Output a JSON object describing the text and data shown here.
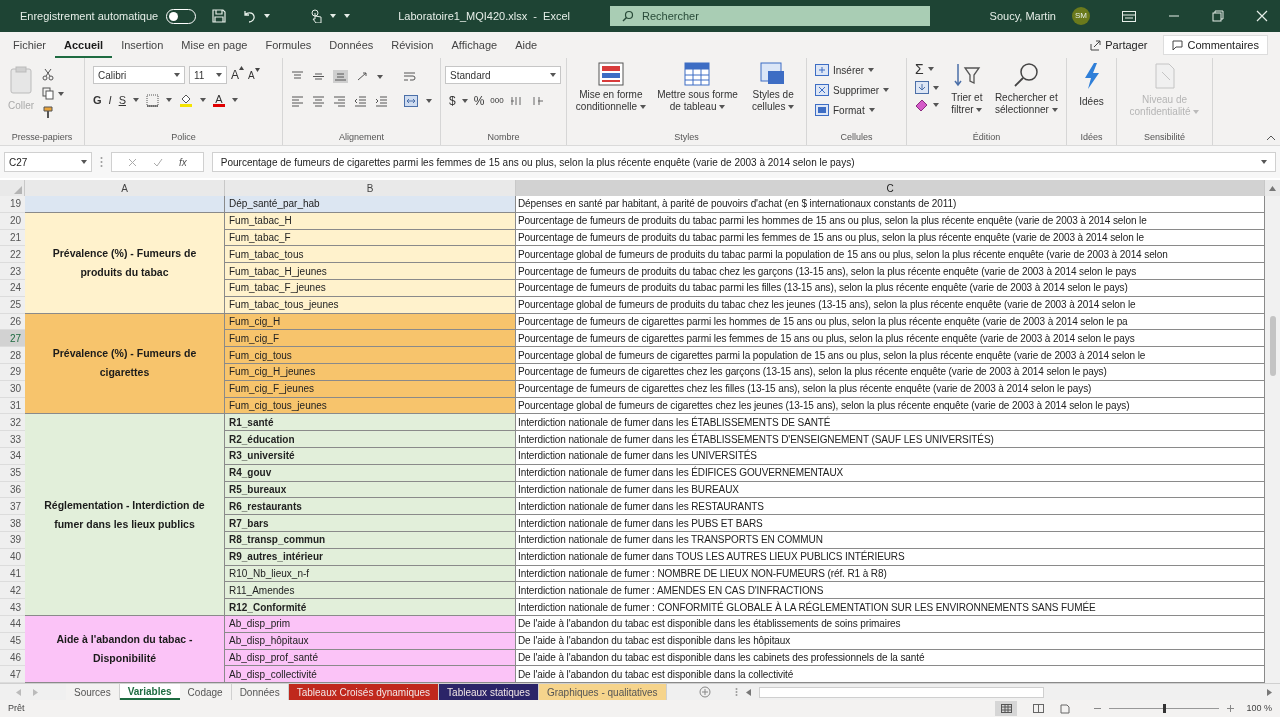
{
  "title_bar": {
    "autosave_label": "Enregistrement automatique",
    "autosave_on": false,
    "file_name": "Laboratoire1_MQI420.xlsx  -  Excel",
    "search_placeholder": "Rechercher",
    "user_name": "Soucy, Martin",
    "user_initials": "SM"
  },
  "menu_tabs": [
    {
      "label": "Fichier",
      "selected": false
    },
    {
      "label": "Accueil",
      "selected": true
    },
    {
      "label": "Insertion",
      "selected": false
    },
    {
      "label": "Mise en page",
      "selected": false
    },
    {
      "label": "Formules",
      "selected": false
    },
    {
      "label": "Données",
      "selected": false
    },
    {
      "label": "Révision",
      "selected": false
    },
    {
      "label": "Affichage",
      "selected": false
    },
    {
      "label": "Aide",
      "selected": false
    }
  ],
  "share_button": "Partager",
  "comments_button": "Commentaires",
  "ribbon": {
    "clipboard": {
      "label": "Presse-papiers",
      "paste": "Coller",
      "paste_disabled": true
    },
    "font": {
      "label": "Police",
      "font_name": "Calibri",
      "font_size": "11",
      "grow": "A",
      "shrink": "A",
      "bold": "G",
      "italic": "I",
      "underline": "S",
      "font_color": "A"
    },
    "alignment": {
      "label": "Alignement"
    },
    "number": {
      "label": "Nombre",
      "format": "Standard",
      "currency": "$",
      "percent": "%",
      "thousands": "000"
    },
    "styles": {
      "label": "Styles",
      "buttons": [
        "Mise en forme conditionnelle",
        "Mettre sous forme de tableau",
        "Styles de cellules"
      ]
    },
    "cells": {
      "label": "Cellules",
      "buttons": [
        "Insérer",
        "Supprimer",
        "Format"
      ]
    },
    "editing": {
      "label": "Édition",
      "sum": "Σ",
      "sort": "Trier et filtrer",
      "find": "Rechercher et sélectionner"
    },
    "ideas": {
      "label": "Idées",
      "button": "Idées"
    },
    "sensitivity": {
      "label": "Sensibilité",
      "button": "Niveau de confidentialité",
      "disabled": true
    }
  },
  "formula_bar": {
    "name_box": "C27",
    "function_label": "fx",
    "formula": "Pourcentage de fumeurs de cigarettes parmi les femmes de 15 ans ou plus, selon la plus récente enquête (varie de 2003 à 2014 selon le pays)"
  },
  "columns": [
    {
      "label": "A",
      "selected": false
    },
    {
      "label": "B",
      "selected": false
    },
    {
      "label": "C",
      "selected": true
    }
  ],
  "groups": [
    {
      "color": "#dce6f2",
      "rows": [
        {
          "number": "19",
          "selected": false,
          "bold": false,
          "variable": "Dép_santé_par_hab",
          "description": "Dépenses en santé par habitant, à parité de pouvoirs d'achat (en $ internationaux constants de 2011)"
        }
      ]
    },
    {
      "label": "Prévalence (%) - Fumeurs de produits du tabac",
      "color": "#fff2cc",
      "rows": [
        {
          "number": "20",
          "selected": false,
          "bold": false,
          "variable": "Fum_tabac_H",
          "description": "Pourcentage de fumeurs de produits du tabac parmi les hommes de 15 ans ou plus, selon la plus récente enquête (varie de 2003 à 2014 selon le"
        },
        {
          "number": "21",
          "selected": false,
          "bold": false,
          "variable": "Fum_tabac_F",
          "description": "Pourcentage de fumeurs de produits du tabac parmi les femmes de 15 ans ou plus, selon la plus récente enquête (varie de 2003 à 2014 selon le"
        },
        {
          "number": "22",
          "selected": false,
          "bold": false,
          "variable": "Fum_tabac_tous",
          "description": "Pourcentage global de fumeurs de produits du tabac parmi la population de 15 ans ou plus, selon la plus récente enquête (varie de 2003 à 2014 selon"
        },
        {
          "number": "23",
          "selected": false,
          "bold": false,
          "variable": "Fum_tabac_H_jeunes",
          "description": "Pourcentage de fumeurs de produits du tabac chez les garçons (13-15 ans), selon la plus récente enquête (varie de 2003 à 2014 selon le pays"
        },
        {
          "number": "24",
          "selected": false,
          "bold": false,
          "variable": "Fum_tabac_F_jeunes",
          "description": "Pourcentage de fumeurs de produits du tabac parmi les filles (13-15 ans), selon la plus récente enquête (varie de 2003 à 2014 selon le pays)"
        },
        {
          "number": "25",
          "selected": false,
          "bold": false,
          "variable": "Fum_tabac_tous_jeunes",
          "description": "Pourcentage global de fumeurs de produits du tabac chez les jeunes (13-15 ans), selon la plus récente enquête (varie de 2003 à 2014 selon le"
        }
      ]
    },
    {
      "label": "Prévalence (%) - Fumeurs de cigarettes",
      "color": "#f7c46c",
      "rows": [
        {
          "number": "26",
          "selected": false,
          "bold": false,
          "variable": "Fum_cig_H",
          "description": "Pourcentage de fumeurs de cigarettes parmi les hommes de 15 ans ou plus, selon la plus récente enquête (varie de 2003 à 2014 selon le pa"
        },
        {
          "number": "27",
          "selected": true,
          "bold": false,
          "variable": "Fum_cig_F",
          "description": "Pourcentage de fumeurs de cigarettes parmi les femmes de 15 ans ou plus, selon la plus récente enquête (varie de 2003 à 2014 selon le pays"
        },
        {
          "number": "28",
          "selected": false,
          "bold": false,
          "variable": "Fum_cig_tous",
          "description": "Pourcentage global de fumeurs de cigarettes parmi la population de 15 ans ou plus, selon la plus récente enquête (varie de 2003 à 2014 selon le"
        },
        {
          "number": "29",
          "selected": false,
          "bold": false,
          "variable": "Fum_cig_H_jeunes",
          "description": "Pourcentage de fumeurs de cigarettes chez les garçons (13-15 ans), selon la plus récente enquête (varie de 2003 à 2014 selon le pays)"
        },
        {
          "number": "30",
          "selected": false,
          "bold": false,
          "variable": "Fum_cig_F_jeunes",
          "description": "Pourcentage de fumeurs de cigarettes chez les filles (13-15 ans), selon la plus récente enquête (varie de 2003 à 2014 selon le pays)"
        },
        {
          "number": "31",
          "selected": false,
          "bold": false,
          "variable": "Fum_cig_tous_jeunes",
          "description": "Pourcentage global de fumeurs de cigarettes chez les jeunes (13-15 ans), selon la plus récente enquête (varie de 2003 à 2014 selon le pays)"
        }
      ]
    },
    {
      "label": "Réglementation - Interdiction de fumer dans les lieux publics",
      "color": "#e2efda",
      "rows": [
        {
          "number": "32",
          "selected": false,
          "bold": true,
          "variable": "R1_santé",
          "description": "Interdiction nationale de fumer dans les ÉTABLISSEMENTS DE SANTÉ"
        },
        {
          "number": "33",
          "selected": false,
          "bold": true,
          "variable": "R2_éducation",
          "description": "Interdiction nationale de fumer dans les ÉTABLISSEMENTS D'ENSEIGNEMENT (SAUF LES UNIVERSITÉS)"
        },
        {
          "number": "34",
          "selected": false,
          "bold": true,
          "variable": "R3_université",
          "description": "Interdiction nationale de fumer dans les UNIVERSITÉS"
        },
        {
          "number": "35",
          "selected": false,
          "bold": true,
          "variable": "R4_gouv",
          "description": "Interdiction nationale de fumer dans les ÉDIFICES GOUVERNEMENTAUX"
        },
        {
          "number": "36",
          "selected": false,
          "bold": true,
          "variable": "R5_bureaux",
          "description": "Interdiction nationale de fumer dans les BUREAUX"
        },
        {
          "number": "37",
          "selected": false,
          "bold": true,
          "variable": "R6_restaurants",
          "description": "Interdiction nationale de fumer dans les RESTAURANTS"
        },
        {
          "number": "38",
          "selected": false,
          "bold": true,
          "variable": "R7_bars",
          "description": "Interdiction nationale de fumer dans les PUBS ET BARS"
        },
        {
          "number": "39",
          "selected": false,
          "bold": true,
          "variable": "R8_transp_commun",
          "description": "Interdiction nationale de fumer dans les TRANSPORTS EN COMMUN"
        },
        {
          "number": "40",
          "selected": false,
          "bold": true,
          "variable": "R9_autres_intérieur",
          "description": "Interdiction nationale de fumer dans TOUS LES AUTRES LIEUX PUBLICS INTÉRIEURS"
        },
        {
          "number": "41",
          "selected": false,
          "bold": false,
          "variable": "R10_Nb_lieux_n-f",
          "description": "Interdiction nationale de fumer : NOMBRE DE LIEUX NON-FUMEURS (réf. R1 à R8)"
        },
        {
          "number": "42",
          "selected": false,
          "bold": false,
          "variable": "R11_Amendes",
          "description": "Interdiction nationale de fumer : AMENDES EN CAS D'INFRACTIONS"
        },
        {
          "number": "43",
          "selected": false,
          "bold": true,
          "variable": "R12_Conformité",
          "description": "Interdiction nationale de fumer : CONFORMITÉ GLOBALE À LA RÉGLEMENTATION SUR LES ENVIRONNEMENTS SANS FUMÉE"
        }
      ]
    },
    {
      "label": "Aide à l'abandon du tabac - Disponibilité",
      "color": "#fbc3f7",
      "rows": [
        {
          "number": "44",
          "selected": false,
          "bold": false,
          "variable": "Ab_disp_prim",
          "description": "De l'aide à l'abandon du tabac est disponible dans les établissements de soins primaires"
        },
        {
          "number": "45",
          "selected": false,
          "bold": false,
          "variable": "Ab_disp_hôpitaux",
          "description": "De l'aide à l'abandon du tabac est disponible dans les hôpitaux"
        },
        {
          "number": "46",
          "selected": false,
          "bold": false,
          "variable": "Ab_disp_prof_santé",
          "description": "De l'aide à l'abandon du tabac est disponible dans les cabinets des professionnels de la santé"
        },
        {
          "number": "47",
          "selected": false,
          "bold": false,
          "variable": "Ab_disp_collectivité",
          "description": "De l'aide à l'abandon du tabac est disponible dans la collectivité"
        }
      ]
    }
  ],
  "sheet_tabs": [
    {
      "label": "Sources",
      "selected": false,
      "color": "#f3f2f1"
    },
    {
      "label": "Variables",
      "selected": true,
      "color": "#ffffff"
    },
    {
      "label": "Codage",
      "selected": false,
      "color": "#f3f2f1"
    },
    {
      "label": "Données",
      "selected": false,
      "color": "#f3f2f1"
    },
    {
      "label": "Tableaux Croisés dynamiques",
      "selected": false,
      "color": "#c0281c"
    },
    {
      "label": "Tableaux statiques",
      "selected": false,
      "color": "#2b2468"
    },
    {
      "label": "Graphiques - qualitatives",
      "selected": false,
      "color": "#f6d48c"
    }
  ],
  "status_bar": {
    "status": "Prêt",
    "zoom": {
      "level": 0.5
    },
    "zoom_reading": "100 %"
  }
}
